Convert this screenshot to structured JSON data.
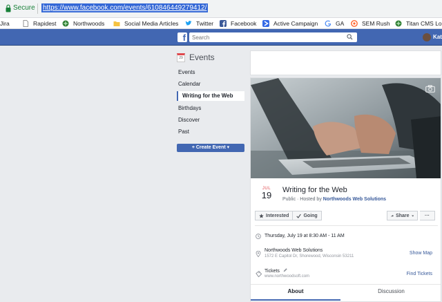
{
  "browser": {
    "secure_label": "Secure",
    "url": "https://www.facebook.com/events/610846449279412/"
  },
  "bookmarks": [
    {
      "label": "Jira",
      "color": "#5a6a7a"
    },
    {
      "label": "Rapidest",
      "color": "#9aa0a6"
    },
    {
      "label": "Northwoods",
      "color": "#2e7d32"
    },
    {
      "label": "Social Media Articles",
      "color": "#f6c342"
    },
    {
      "label": "Twitter",
      "color": "#1da1f2"
    },
    {
      "label": "Facebook",
      "color": "#3b5998"
    },
    {
      "label": "Active Campaign",
      "color": "#356ae6"
    },
    {
      "label": "GA",
      "color": "#4285f4"
    },
    {
      "label": "SEM Rush",
      "color": "#ff642d"
    },
    {
      "label": "Titan CMS Lo",
      "color": "#2e7d32"
    }
  ],
  "fb": {
    "logo": "f",
    "search_placeholder": "Search",
    "user_name": "Kat"
  },
  "nav": {
    "title": "Events",
    "cal_day": "29",
    "items": [
      "Events",
      "Calendar",
      "Writing for the Web",
      "Birthdays",
      "Discover",
      "Past"
    ],
    "create_label": "+ Create Event ▾"
  },
  "event": {
    "month": "JUL",
    "day": "19",
    "title": "Writing for the Web",
    "visibility": "Public",
    "hosted_by": "· Hosted by",
    "host": "Northwoods Web Solutions",
    "interested_label": "Interested",
    "going_label": "Going",
    "share_label": "Share",
    "more_label": "···",
    "datetime": "Thursday, July 19 at 8:30 AM - 11 AM",
    "location_name": "Northwoods Web Solutions",
    "location_address": "1572 E Capitol Dr, Shorewood, Wisconsin 53211",
    "show_map_label": "Show Map",
    "tickets_label": "Tickets",
    "tickets_url": "www.northwoodsoft.com",
    "find_tickets_label": "Find Tickets",
    "tabs": [
      "About",
      "Discussion"
    ]
  },
  "colors": {
    "fb_blue": "#4267b2",
    "link": "#365899",
    "accent_red": "#e0484d"
  }
}
